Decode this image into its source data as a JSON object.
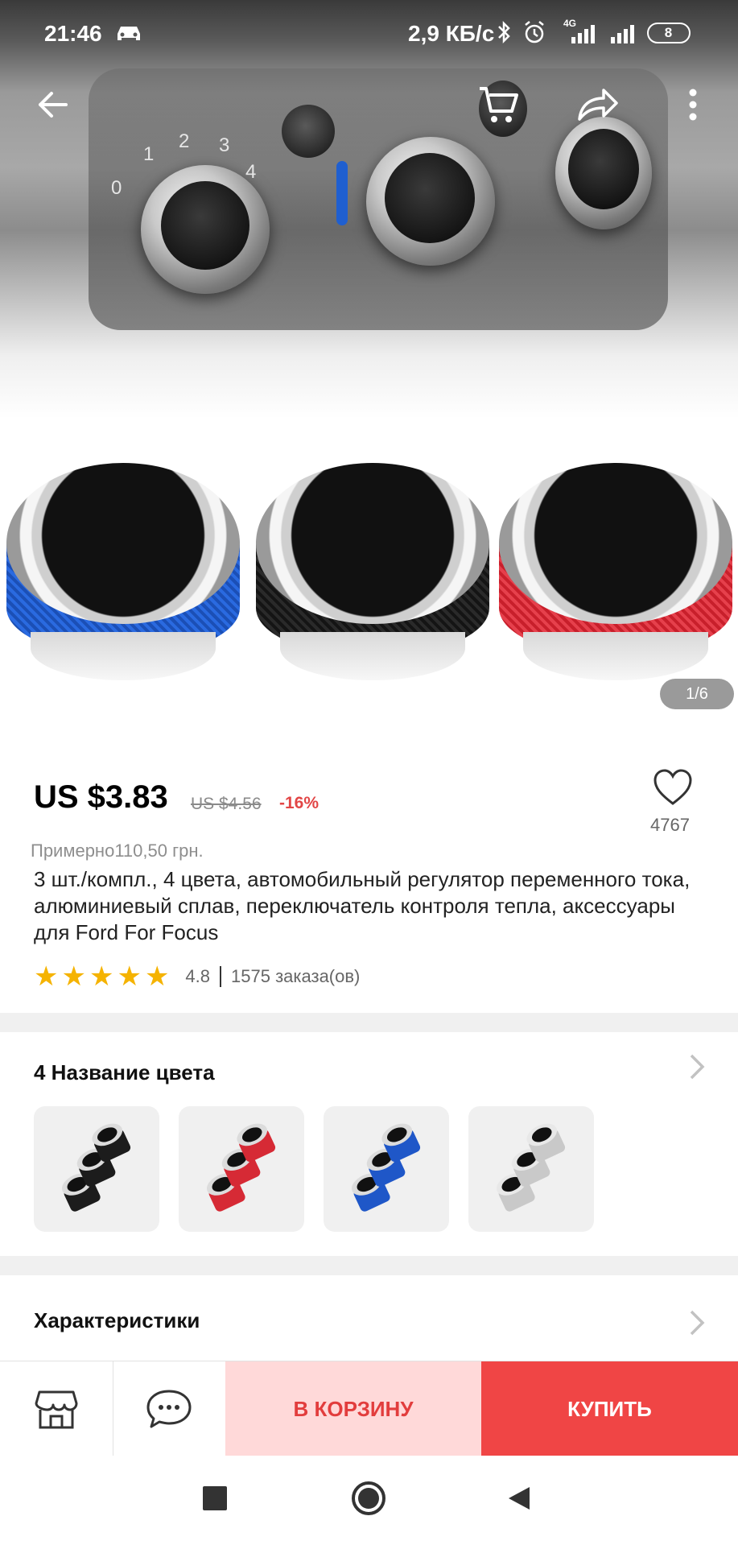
{
  "status_bar": {
    "time": "21:46",
    "network_speed": "2,9 КБ/с",
    "signal_label": "4G",
    "battery": "8"
  },
  "gallery": {
    "counter": "1/6",
    "dial_numbers": [
      "0",
      "1",
      "2",
      "3",
      "4"
    ]
  },
  "product": {
    "price": "US $3.83",
    "old_price": "US $4.56",
    "discount": "-16%",
    "approx_price": "Примерно110,50 грн.",
    "title": "3 шт./компл., 4 цвета, автомобильный регулятор переменного тока, алюминиевый сплав, переключатель контроля тепла, аксессуары для Ford For Focus",
    "rating": "4.8",
    "orders": "1575 заказа(ов)",
    "wishlist_count": "4767"
  },
  "color_section": {
    "title": "4 Название цвета",
    "options": [
      {
        "name": "black",
        "accent": "#1c1c1c"
      },
      {
        "name": "red",
        "accent": "#d62a35"
      },
      {
        "name": "blue",
        "accent": "#1f57c8"
      },
      {
        "name": "silver",
        "accent": "#c9c9c9"
      }
    ]
  },
  "specs_section": {
    "title": "Характеристики"
  },
  "action_bar": {
    "add_to_cart": "В КОРЗИНУ",
    "buy": "КУПИТЬ"
  },
  "colors": {
    "accent_red": "#f04545",
    "cart_bg": "#ffd9d9",
    "star": "#f5b301"
  }
}
